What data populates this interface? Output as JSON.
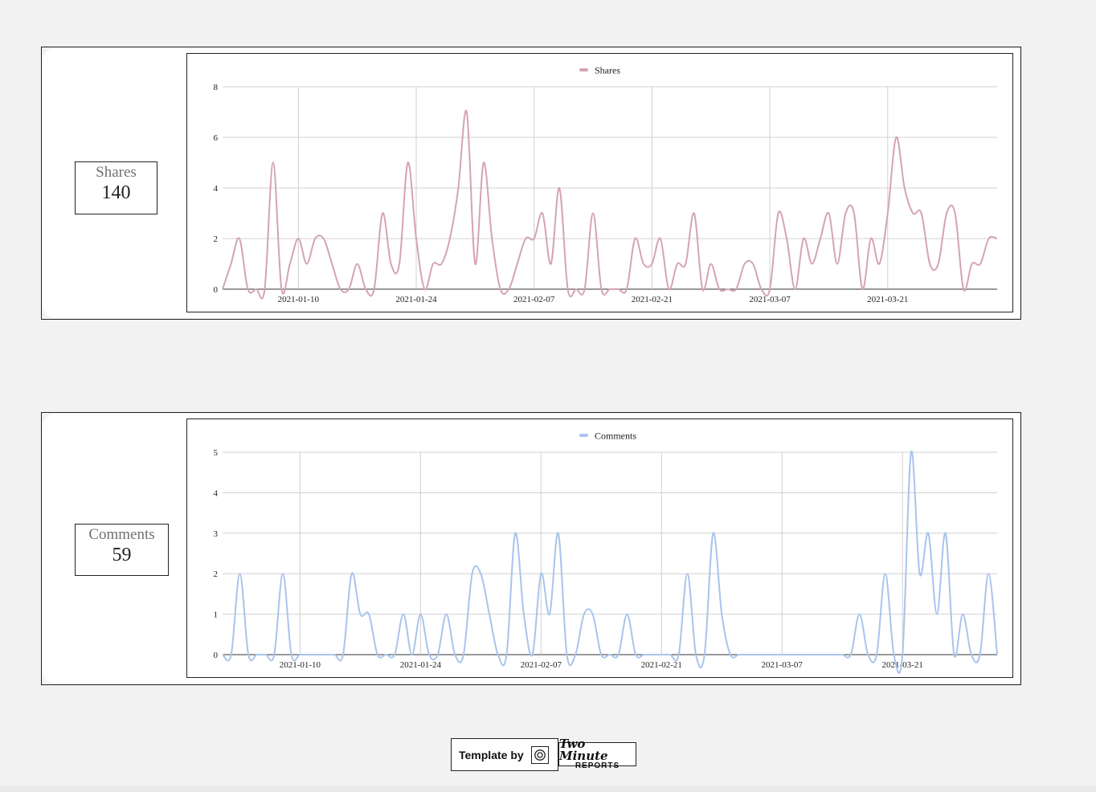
{
  "scorecards": [
    {
      "label": "Shares",
      "value": "140"
    },
    {
      "label": "Comments",
      "value": "59"
    }
  ],
  "footer": {
    "credit": "Template by",
    "logo_line1": "Two Minute",
    "logo_line2": "REPORTS",
    "icon": "camera-icon"
  },
  "chart_data": [
    {
      "type": "line",
      "smooth": true,
      "legend": "top-center",
      "grid": true,
      "color": "#d4a3b7",
      "series": [
        {
          "name": "Shares"
        }
      ],
      "x_start": "2021-01-01",
      "x_ticks": [
        "2021-01-10",
        "2021-01-24",
        "2021-02-07",
        "2021-02-21",
        "2021-03-07",
        "2021-03-21"
      ],
      "ylim": [
        0,
        8
      ],
      "y_ticks": [
        0,
        2,
        4,
        6,
        8
      ],
      "x": [
        "2021-01-01",
        "2021-01-02",
        "2021-01-03",
        "2021-01-04",
        "2021-01-05",
        "2021-01-06",
        "2021-01-07",
        "2021-01-08",
        "2021-01-09",
        "2021-01-10",
        "2021-01-11",
        "2021-01-12",
        "2021-01-13",
        "2021-01-14",
        "2021-01-15",
        "2021-01-16",
        "2021-01-17",
        "2021-01-18",
        "2021-01-19",
        "2021-01-20",
        "2021-01-21",
        "2021-01-22",
        "2021-01-23",
        "2021-01-24",
        "2021-01-25",
        "2021-01-26",
        "2021-01-27",
        "2021-01-28",
        "2021-01-29",
        "2021-01-30",
        "2021-01-31",
        "2021-02-01",
        "2021-02-02",
        "2021-02-03",
        "2021-02-04",
        "2021-02-05",
        "2021-02-06",
        "2021-02-07",
        "2021-02-08",
        "2021-02-09",
        "2021-02-10",
        "2021-02-11",
        "2021-02-12",
        "2021-02-13",
        "2021-02-14",
        "2021-02-15",
        "2021-02-16",
        "2021-02-17",
        "2021-02-18",
        "2021-02-19",
        "2021-02-20",
        "2021-02-21",
        "2021-02-22",
        "2021-02-23",
        "2021-02-24",
        "2021-02-25",
        "2021-02-26",
        "2021-02-27",
        "2021-02-28",
        "2021-03-01",
        "2021-03-02",
        "2021-03-03",
        "2021-03-04",
        "2021-03-05",
        "2021-03-06",
        "2021-03-07",
        "2021-03-08",
        "2021-03-09",
        "2021-03-10",
        "2021-03-11",
        "2021-03-12",
        "2021-03-13",
        "2021-03-14",
        "2021-03-15",
        "2021-03-16",
        "2021-03-17",
        "2021-03-18",
        "2021-03-19",
        "2021-03-20",
        "2021-03-21",
        "2021-03-22",
        "2021-03-23",
        "2021-03-24",
        "2021-03-25",
        "2021-03-26",
        "2021-03-27",
        "2021-03-28",
        "2021-03-29",
        "2021-03-30",
        "2021-03-31"
      ],
      "values": [
        0,
        1,
        2,
        0,
        0,
        0,
        5,
        0,
        1,
        2,
        1,
        2,
        2,
        1,
        0,
        0,
        1,
        0,
        0,
        3,
        1,
        1,
        5,
        2,
        0,
        1,
        1,
        2,
        4,
        7,
        1,
        5,
        2,
        0,
        0,
        1,
        2,
        2,
        3,
        1,
        4,
        0,
        0,
        0,
        3,
        0,
        0,
        0,
        0,
        2,
        1,
        1,
        2,
        0,
        1,
        1,
        3,
        0,
        1,
        0,
        0,
        0,
        1,
        1,
        0,
        0,
        3,
        2,
        0,
        2,
        1,
        2,
        3,
        1,
        3,
        3,
        0,
        2,
        1,
        3,
        6,
        4,
        3,
        3,
        1,
        1,
        3,
        3,
        0,
        1,
        1,
        2,
        2
      ],
      "values_note": ""
    },
    {
      "type": "line",
      "smooth": true,
      "legend": "top-center",
      "grid": true,
      "color": "#a9c4ec",
      "series": [
        {
          "name": "Comments"
        }
      ],
      "x_start": "2021-01-01",
      "x_ticks": [
        "2021-01-10",
        "2021-01-24",
        "2021-02-07",
        "2021-02-21",
        "2021-03-07",
        "2021-03-21"
      ],
      "ylim": [
        0,
        5
      ],
      "y_ticks": [
        0,
        1,
        2,
        3,
        4,
        5
      ],
      "x": [
        "2021-01-01",
        "2021-01-02",
        "2021-01-03",
        "2021-01-04",
        "2021-01-05",
        "2021-01-06",
        "2021-01-07",
        "2021-01-08",
        "2021-01-09",
        "2021-01-10",
        "2021-01-11",
        "2021-01-12",
        "2021-01-13",
        "2021-01-14",
        "2021-01-15",
        "2021-01-16",
        "2021-01-17",
        "2021-01-18",
        "2021-01-19",
        "2021-01-20",
        "2021-01-21",
        "2021-01-22",
        "2021-01-23",
        "2021-01-24",
        "2021-01-25",
        "2021-01-26",
        "2021-01-27",
        "2021-01-28",
        "2021-01-29",
        "2021-01-30",
        "2021-01-31",
        "2021-02-01",
        "2021-02-02",
        "2021-02-03",
        "2021-02-04",
        "2021-02-05",
        "2021-02-06",
        "2021-02-07",
        "2021-02-08",
        "2021-02-09",
        "2021-02-10",
        "2021-02-11",
        "2021-02-12",
        "2021-02-13",
        "2021-02-14",
        "2021-02-15",
        "2021-02-16",
        "2021-02-17",
        "2021-02-18",
        "2021-02-19",
        "2021-02-20",
        "2021-02-21",
        "2021-02-22",
        "2021-02-23",
        "2021-02-24",
        "2021-02-25",
        "2021-02-26",
        "2021-02-27",
        "2021-02-28",
        "2021-03-01",
        "2021-03-02",
        "2021-03-03",
        "2021-03-04",
        "2021-03-05",
        "2021-03-06",
        "2021-03-07",
        "2021-03-08",
        "2021-03-09",
        "2021-03-10",
        "2021-03-11",
        "2021-03-12",
        "2021-03-13",
        "2021-03-14",
        "2021-03-15",
        "2021-03-16",
        "2021-03-17",
        "2021-03-18",
        "2021-03-19",
        "2021-03-20",
        "2021-03-21",
        "2021-03-22",
        "2021-03-23",
        "2021-03-24",
        "2021-03-25",
        "2021-03-26",
        "2021-03-27",
        "2021-03-28",
        "2021-03-29",
        "2021-03-30",
        "2021-03-31"
      ],
      "values": [
        0,
        0,
        2,
        0,
        0,
        0,
        0,
        2,
        0,
        0,
        0,
        0,
        0,
        0,
        0,
        2,
        1,
        1,
        0,
        0,
        0,
        1,
        0,
        1,
        0,
        0,
        1,
        0,
        0,
        2,
        2,
        1,
        0,
        0,
        3,
        1,
        0,
        2,
        1,
        3,
        0,
        0,
        1,
        1,
        0,
        0,
        0,
        1,
        0,
        0,
        0,
        0,
        0,
        0,
        2,
        0,
        0,
        3,
        1,
        0,
        0,
        0,
        0,
        0,
        0,
        0,
        0,
        0,
        0,
        0,
        0,
        0,
        0,
        0,
        1,
        0,
        0,
        2,
        0,
        0,
        5,
        2,
        3,
        1,
        3,
        0,
        1,
        0,
        0,
        2,
        0
      ]
    }
  ]
}
